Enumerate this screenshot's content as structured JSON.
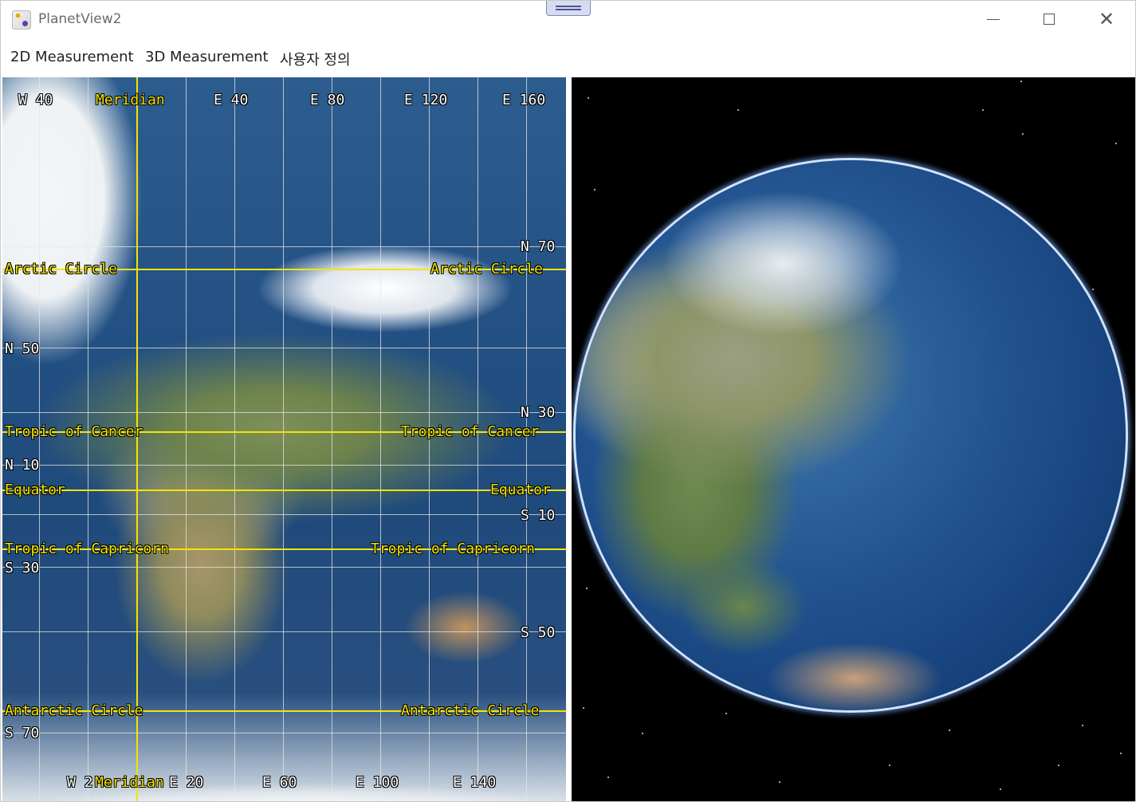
{
  "window": {
    "title": "PlanetView2"
  },
  "menu": {
    "items": [
      "2D Measurement",
      "3D Measurement",
      "사용자 정의"
    ]
  },
  "map2d": {
    "top_longitude_labels": [
      "W 40",
      "Meridian",
      "E 40",
      "E 80",
      "E 120",
      "E 160"
    ],
    "bottom_longitude_labels": [
      "W 2",
      "Meridian",
      "E 20",
      "E 60",
      "E 100",
      "E 140"
    ],
    "right_latitude_labels": {
      "n70": "N 70",
      "n30": "N 30",
      "s10": "S 10",
      "s50": "S 50"
    },
    "left_latitude_labels": {
      "n50": "N 50",
      "n10": "N 10",
      "s30": "S 30",
      "s70": "S 70"
    },
    "circles": {
      "arctic": "Arctic Circle",
      "cancer": "Tropic of Cancer",
      "equator": "Equator",
      "capricorn": "Tropic of Capricorn",
      "antarctic": "Antarctic Circle"
    }
  },
  "colors": {
    "grid_yellow": "#f5e400",
    "space": "#000000",
    "atmosphere": "#cfe4ff"
  }
}
